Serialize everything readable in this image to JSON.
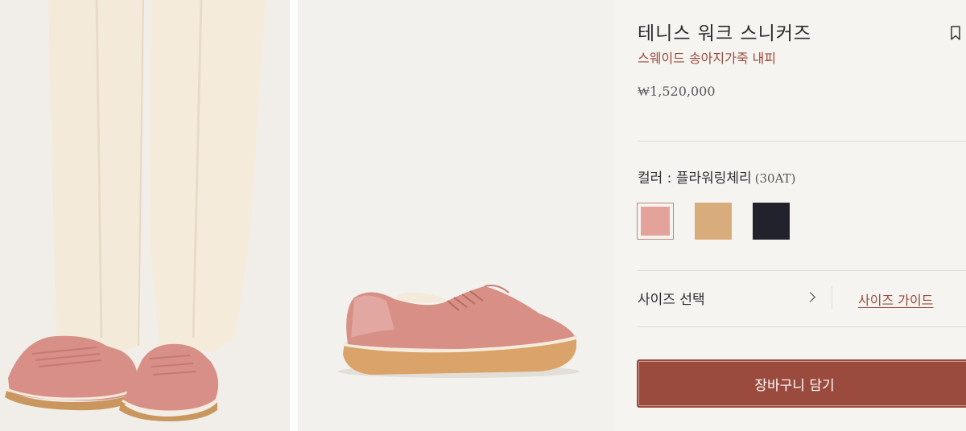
{
  "product": {
    "title": "테니스 워크 스니커즈",
    "subtitle": "스웨이드 송아지가죽 내피",
    "price": "₩1,520,000"
  },
  "color": {
    "label": "컬러 : 플라워링체리",
    "code": "(30AT)",
    "swatches": [
      {
        "name": "pink",
        "hex": "#e3a29a",
        "selected": true
      },
      {
        "name": "tan",
        "hex": "#d9ac7c",
        "selected": false
      },
      {
        "name": "navy",
        "hex": "#22222c",
        "selected": false
      }
    ]
  },
  "size": {
    "select_label": "사이즈 선택",
    "guide_label": "사이즈 가이드"
  },
  "cart": {
    "button_label": "장바구니 담기"
  },
  "colors": {
    "accent": "#9b4a3e",
    "background": "#f6f4f0"
  },
  "icons": {
    "bookmark": "bookmark-icon",
    "chevron": "chevron-right-icon"
  }
}
